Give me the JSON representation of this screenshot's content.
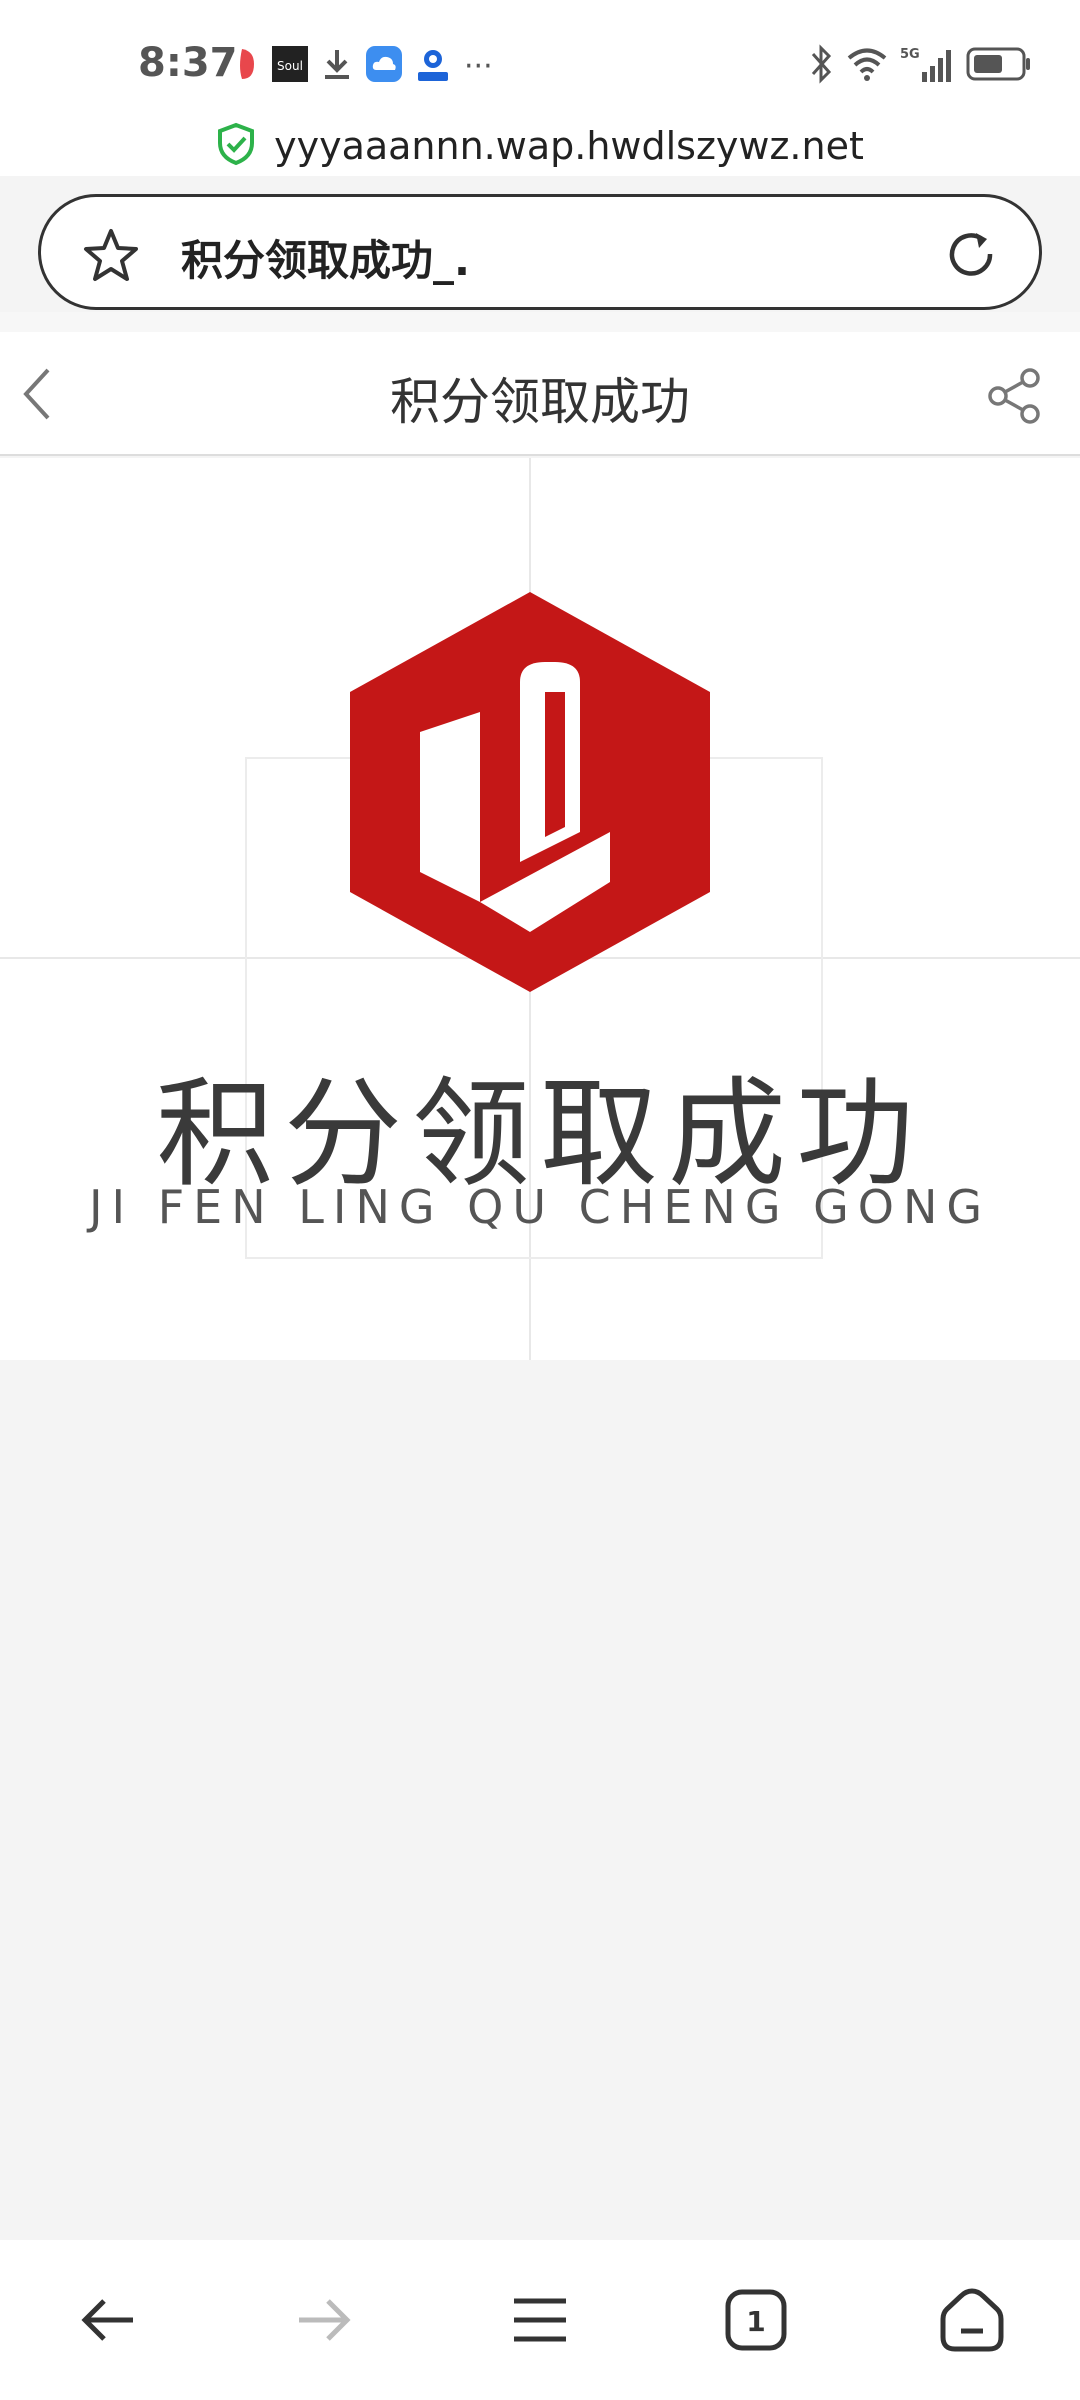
{
  "status_bar": {
    "time": "8:37",
    "left_icons": [
      "app-red-icon",
      "soul-app-icon",
      "download-icon",
      "cloud-app-icon",
      "pin-app-icon"
    ],
    "more": "···",
    "soul_label": "Soul",
    "network": "5G",
    "right_icons": [
      "bluetooth-icon",
      "wifi-icon",
      "signal-icon",
      "battery-icon"
    ]
  },
  "browser": {
    "url": "yyyaaannn.wap.hwdlszywz.net",
    "tab_title": "积分领取成功_.",
    "secure_color": "#2db24a"
  },
  "page": {
    "header_title": "积分领取成功",
    "banner": {
      "logo_text": "积分领取成功",
      "logo_pinyin": "JI FEN LING QU CHENG GONG",
      "logo_color": "#c41717"
    }
  },
  "bottom_nav": {
    "tab_count": "1",
    "items": [
      "back-icon",
      "forward-icon",
      "menu-icon",
      "tabs-icon",
      "home-icon"
    ]
  }
}
